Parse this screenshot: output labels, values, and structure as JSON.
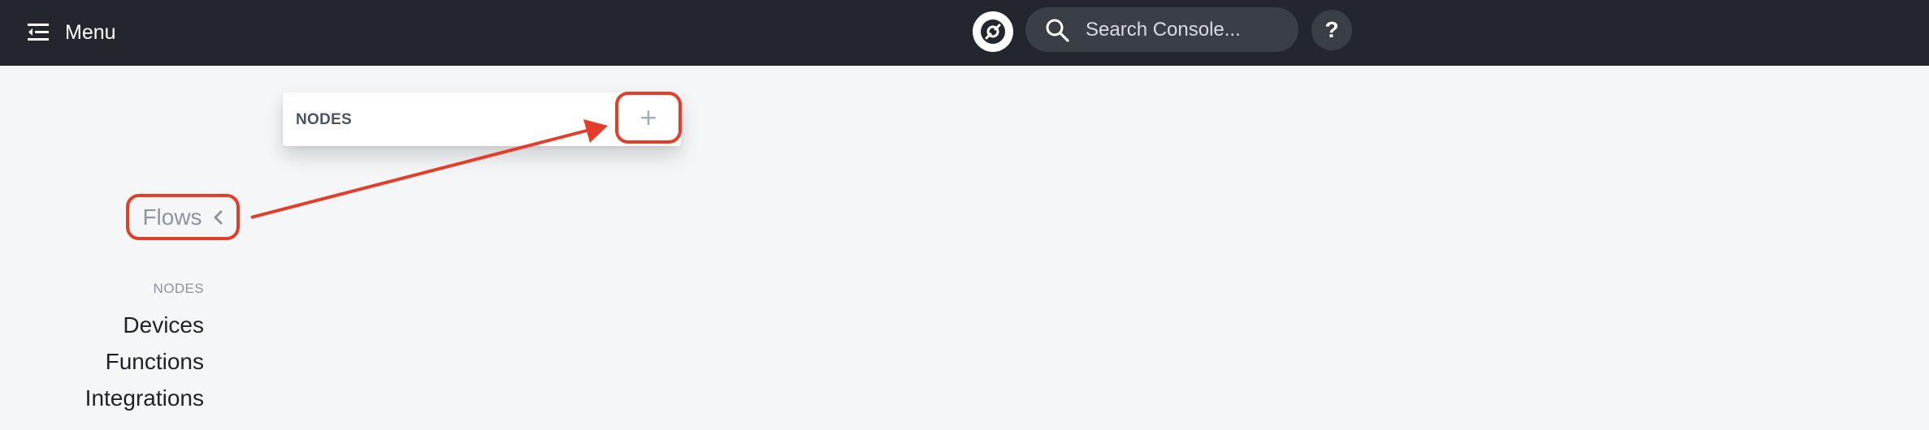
{
  "topbar": {
    "menu_label": "Menu",
    "search_placeholder": "Search Console...",
    "help_label": "?"
  },
  "node_panel": {
    "title": "NODES",
    "add_label": "+"
  },
  "flows": {
    "label": "Flows"
  },
  "sidebar": {
    "section_label": "NODES",
    "items": [
      {
        "label": "Devices"
      },
      {
        "label": "Functions"
      },
      {
        "label": "Integrations"
      }
    ]
  },
  "colors": {
    "topbar": "#23272d",
    "background": "#f5f6f8",
    "highlight": "#e23e29"
  },
  "icons": [
    "menu-icon",
    "helium-logo-icon",
    "search-icon",
    "chevron-left-icon",
    "plus-icon"
  ]
}
